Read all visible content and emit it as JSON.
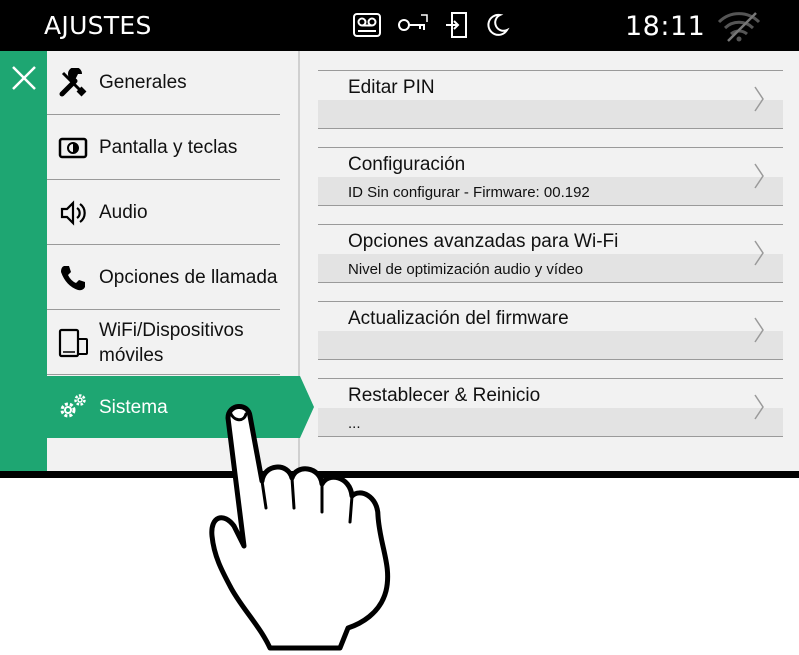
{
  "topbar": {
    "title": "AJUSTES",
    "clock": "18:11",
    "status_icons": [
      "voicemail-icon",
      "key-icon",
      "door-entry-icon",
      "moon-icon",
      "wifi-off-icon"
    ]
  },
  "colors": {
    "accent": "#1ea672",
    "background": "#f2f2f2",
    "band": "#e3e3e3",
    "topbar": "#000000"
  },
  "sidebar": {
    "items": [
      {
        "label": "Generales",
        "icon": "wrench-screwdriver-icon",
        "active": false
      },
      {
        "label": "Pantalla y teclas",
        "icon": "brightness-icon",
        "active": false
      },
      {
        "label": "Audio",
        "icon": "speaker-icon",
        "active": false
      },
      {
        "label": "Opciones de llamada",
        "icon": "phone-icon",
        "active": false
      },
      {
        "label": "WiFi/Dispositivos móviles",
        "label_line1": "WiFi/Dispositivos",
        "label_line2": "móviles",
        "icon": "devices-icon",
        "active": false
      },
      {
        "label": "Sistema",
        "icon": "gears-icon",
        "active": true
      }
    ]
  },
  "main": {
    "rows": [
      {
        "title": "Editar PIN",
        "subtitle": ""
      },
      {
        "title": "Configuración",
        "subtitle": "ID Sin configurar - Firmware: 00.192"
      },
      {
        "title": "Opciones avanzadas para Wi-Fi",
        "subtitle": "Nivel de optimización audio y vídeo"
      },
      {
        "title": "Actualización del firmware",
        "subtitle": ""
      },
      {
        "title": "Restablecer & Reinicio",
        "subtitle": "..."
      }
    ]
  }
}
